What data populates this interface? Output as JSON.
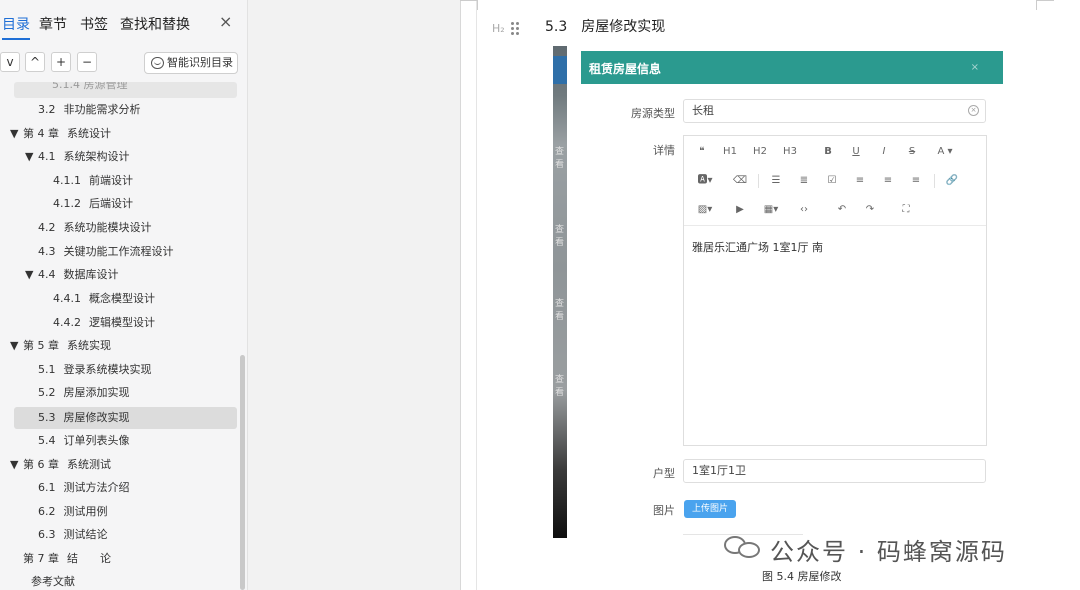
{
  "toc": {
    "tabs": [
      "目录",
      "章节",
      "书签",
      "查找和替换"
    ],
    "close_icon": "×",
    "tools": [
      "v",
      "^",
      "+",
      "−"
    ],
    "ai_button": "智能识别目录",
    "faded_item": "5.1.4 房源管理",
    "items": [
      {
        "num": "3.2",
        "label": "非功能需求分析"
      },
      {
        "num": "第 4 章",
        "label": "系统设计"
      },
      {
        "num": "4.1",
        "label": "系统架构设计"
      },
      {
        "num": "4.1.1",
        "label": "前端设计"
      },
      {
        "num": "4.1.2",
        "label": "后端设计"
      },
      {
        "num": "4.2",
        "label": "系统功能模块设计"
      },
      {
        "num": "4.3",
        "label": "关键功能工作流程设计"
      },
      {
        "num": "4.4",
        "label": "数据库设计"
      },
      {
        "num": "4.4.1",
        "label": "概念模型设计"
      },
      {
        "num": "4.4.2",
        "label": "逻辑模型设计"
      },
      {
        "num": "第 5 章",
        "label": "系统实现"
      },
      {
        "num": "5.1",
        "label": "登录系统模块实现"
      },
      {
        "num": "5.2",
        "label": "房屋添加实现"
      },
      {
        "num": "5.3",
        "label": "房屋修改实现"
      },
      {
        "num": "5.4",
        "label": "订单列表头像"
      },
      {
        "num": "第 6 章",
        "label": "系统测试"
      },
      {
        "num": "6.1",
        "label": "测试方法介绍"
      },
      {
        "num": "6.2",
        "label": "测试用例"
      },
      {
        "num": "6.3",
        "label": "测试结论"
      },
      {
        "num": "第 7 章",
        "label": "结　　论"
      },
      {
        "num": "",
        "label": "参考文献"
      }
    ]
  },
  "doc": {
    "heading_marker": "H₂",
    "section_num": "5.3",
    "section_title": "房屋修改实现",
    "strip_cuts": [
      "查看",
      "查看",
      "查看",
      "查看"
    ],
    "dialog": {
      "title": "租赁房屋信息",
      "close": "×",
      "fields": {
        "type_label": "房源类型",
        "type_value": "长租",
        "detail_label": "详情",
        "detail_text": "雅居乐汇通广场 1室1厅 南",
        "layout_label": "户型",
        "layout_value": "1室1厅1卫",
        "image_label": "图片",
        "upload_label": "上传图片"
      },
      "toolbar_row1": [
        "❝",
        "H1",
        "H2",
        "H3",
        "B",
        "U",
        "I",
        "S",
        "A ▾"
      ],
      "toolbar_row2": [
        "🅰▾",
        "⌫",
        "☰",
        "≣",
        "☑",
        "≡",
        "≡",
        "≡",
        "🔗"
      ],
      "toolbar_row3": [
        "▨▾",
        "▶",
        "▦▾",
        "‹›",
        "↶",
        "↷",
        "⛶"
      ]
    },
    "watermark": "公众号 · 码蜂窝源码",
    "caption": "图 5.4  房屋修改"
  }
}
